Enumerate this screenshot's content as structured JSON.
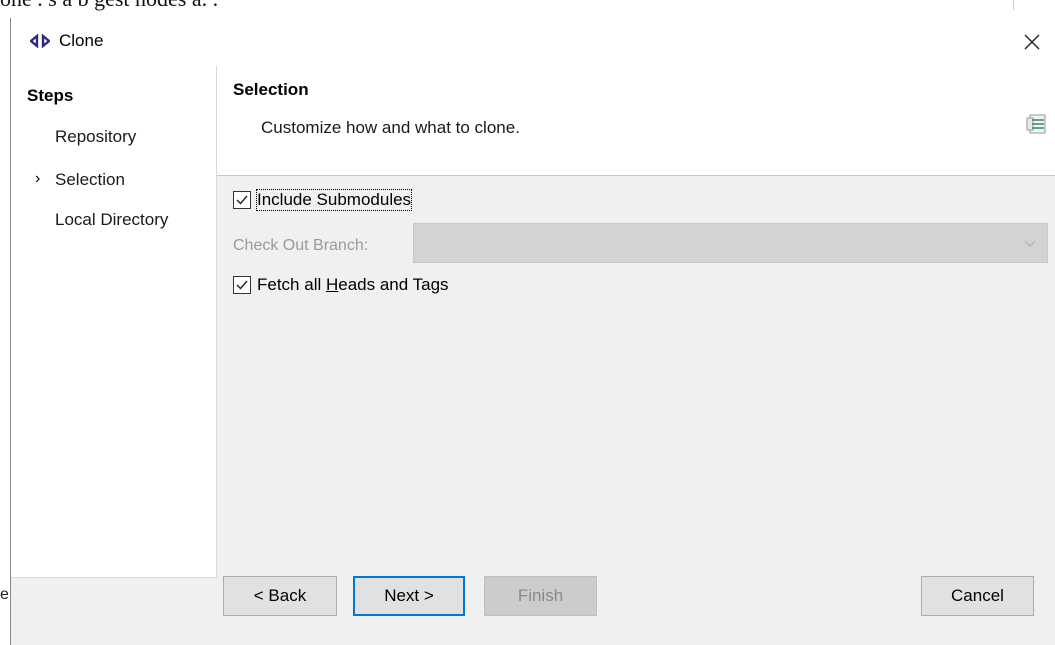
{
  "background": {
    "top_text": "one . s a b gest nodes a.  .",
    "edge_char": "e"
  },
  "window": {
    "title": "Clone",
    "icon": "eclipse-clone-icon",
    "close_icon": "close-icon"
  },
  "steps": {
    "title": "Steps",
    "items": [
      {
        "label": "Repository",
        "current": false
      },
      {
        "label": "Selection",
        "current": true
      },
      {
        "label": "Local Directory",
        "current": false
      }
    ],
    "current_marker": "›"
  },
  "page": {
    "title": "Selection",
    "description": "Customize how and what to clone.",
    "icon": "wizard-banner-icon"
  },
  "form": {
    "include_submodules": {
      "label": "Include Submodules",
      "checked": true
    },
    "checkout_branch": {
      "label": "Check Out Branch:",
      "value": "",
      "enabled": false
    },
    "fetch_all": {
      "label_pre": "Fetch all ",
      "label_mnemonic": "H",
      "label_post": "eads and Tags",
      "checked": true
    }
  },
  "buttons": {
    "back": "< Back",
    "next": "Next >",
    "finish": "Finish",
    "cancel": "Cancel"
  },
  "colors": {
    "default_button_border": "#0078d7",
    "disabled_text": "#9a9a9a",
    "dialog_bg": "#f0f0f0"
  }
}
